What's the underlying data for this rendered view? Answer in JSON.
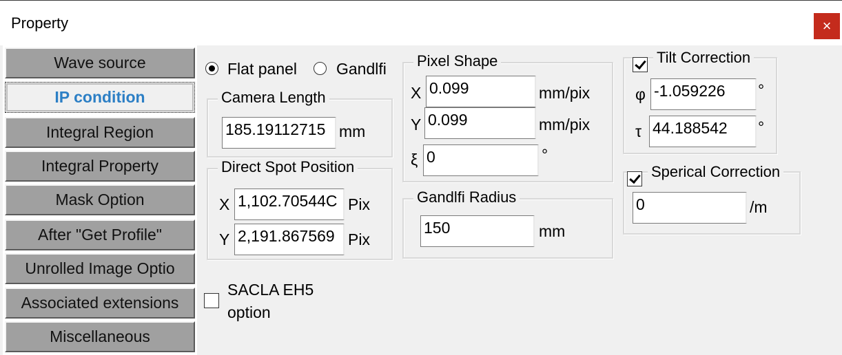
{
  "window": {
    "title": "Property",
    "close_glyph": "×"
  },
  "tabs": [
    {
      "label": "Wave source",
      "active": false
    },
    {
      "label": "IP condition",
      "active": true
    },
    {
      "label": "Integral Region",
      "active": false
    },
    {
      "label": "Integral Property",
      "active": false
    },
    {
      "label": "Mask Option",
      "active": false
    },
    {
      "label": "After \"Get Profile\"",
      "active": false
    },
    {
      "label": "Unrolled  Image Optio",
      "active": false
    },
    {
      "label": "Associated extensions",
      "active": false
    },
    {
      "label": "Miscellaneous",
      "active": false
    }
  ],
  "detector_type": {
    "options": [
      {
        "label": "Flat panel",
        "selected": true
      },
      {
        "label": "Gandlfi",
        "selected": false
      }
    ]
  },
  "camera_length": {
    "legend": "Camera Length",
    "value": "185.19112715",
    "unit": "mm"
  },
  "direct_spot": {
    "legend": "Direct Spot Position",
    "x_label": "X",
    "x_value": "1,102.70544C",
    "x_unit": "Pix",
    "y_label": "Y",
    "y_value": "2,191.867569",
    "y_unit": "Pix"
  },
  "sacla": {
    "label_line1": "SACLA EH5",
    "label_line2": "option",
    "checked": false
  },
  "pixel_shape": {
    "legend": "Pixel Shape",
    "x_label": "X",
    "x_value": "0.099",
    "x_unit": "mm/pix",
    "y_label": "Y",
    "y_value": "0.099",
    "y_unit": "mm/pix",
    "xi_label": "ξ",
    "xi_value": "0",
    "xi_unit": "°"
  },
  "gandlfi_radius": {
    "legend": "Gandlfi Radius",
    "value": "150",
    "unit": "mm"
  },
  "tilt_correction": {
    "label": "Tilt Correction",
    "checked": true,
    "phi_label": "φ",
    "phi_value": "-1.059226",
    "phi_unit": "°",
    "tau_label": "τ",
    "tau_value": "44.188542",
    "tau_unit": "°"
  },
  "sperical_correction": {
    "label": "Sperical Correction",
    "checked": true,
    "value": "0",
    "unit": "/m"
  },
  "colors": {
    "close_button": "#c42b1c",
    "active_tab_text": "#2c7fc5",
    "tab_button": "#a0a0a0"
  }
}
